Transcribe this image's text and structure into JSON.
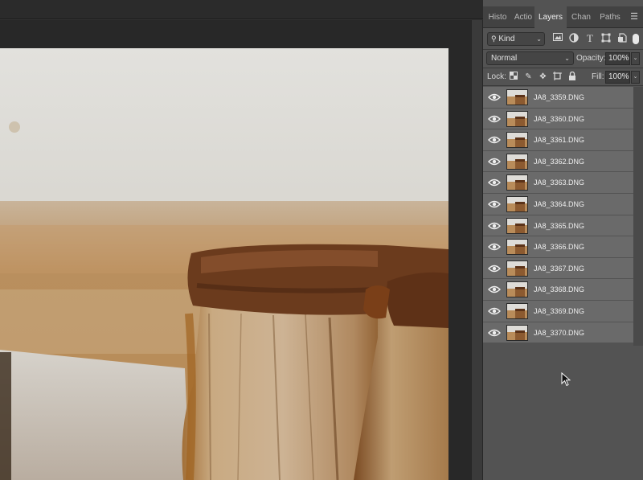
{
  "panel": {
    "tabs": [
      {
        "label": "Histo",
        "active": false
      },
      {
        "label": "Actio",
        "active": false
      },
      {
        "label": "Layers",
        "active": true
      },
      {
        "label": "Chan",
        "active": false
      },
      {
        "label": "Paths",
        "active": false
      }
    ],
    "menu_icon": "hamburger-menu-icon",
    "filter": {
      "kind_label": "Kind",
      "icons": [
        "image-filter-icon",
        "adjustment-filter-icon",
        "type-filter-icon",
        "shape-filter-icon",
        "smart-object-filter-icon"
      ]
    },
    "blend": {
      "mode": "Normal",
      "opacity_label": "Opacity:",
      "opacity_value": "100%"
    },
    "lock": {
      "label": "Lock:",
      "icons": [
        "lock-transparent-pixels-icon",
        "lock-image-pixels-icon",
        "lock-position-icon",
        "lock-artboard-icon",
        "lock-all-icon"
      ],
      "fill_label": "Fill:",
      "fill_value": "100%"
    },
    "layers": [
      {
        "name": "JA8_3359.DNG",
        "visible": true
      },
      {
        "name": "JA8_3360.DNG",
        "visible": true
      },
      {
        "name": "JA8_3361.DNG",
        "visible": true
      },
      {
        "name": "JA8_3362.DNG",
        "visible": true
      },
      {
        "name": "JA8_3363.DNG",
        "visible": true
      },
      {
        "name": "JA8_3364.DNG",
        "visible": true
      },
      {
        "name": "JA8_3365.DNG",
        "visible": true
      },
      {
        "name": "JA8_3366.DNG",
        "visible": true
      },
      {
        "name": "JA8_3367.DNG",
        "visible": true
      },
      {
        "name": "JA8_3368.DNG",
        "visible": true
      },
      {
        "name": "JA8_3369.DNG",
        "visible": true
      },
      {
        "name": "JA8_3370.DNG",
        "visible": true
      }
    ]
  },
  "colors": {
    "panel_bg": "#535353",
    "layer_row": "#6a6a6a",
    "canvas_bg": "#282828"
  }
}
